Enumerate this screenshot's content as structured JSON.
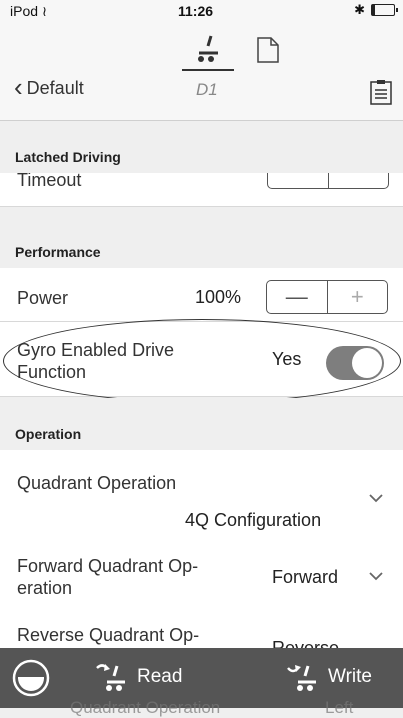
{
  "status_bar": {
    "device": "iPod",
    "time": "11:26"
  },
  "nav": {
    "back_label": "Default",
    "title": "D1"
  },
  "latched_section": {
    "header": "Latched Driving",
    "partial_row_label": "Timeout"
  },
  "performance_section": {
    "header": "Performance",
    "power": {
      "label": "Power",
      "value": "100%",
      "minus": "—",
      "plus": "+"
    },
    "gyro": {
      "label": "Gyro Enabled Drive Function",
      "value": "Yes",
      "enabled": true
    }
  },
  "operation_section": {
    "header": "Operation",
    "rows": [
      {
        "label": "Quadrant Operation",
        "value": "4Q Configuration"
      },
      {
        "label": "Forward Quadrant Op-eration",
        "value": "Forward"
      },
      {
        "label": "Reverse Quadrant Op-",
        "value": "Reverse"
      }
    ],
    "ghost_row": {
      "label": "Quadrant Operation",
      "value": "Left"
    }
  },
  "toolbar": {
    "read_label": "Read",
    "write_label": "Write"
  },
  "colors": {
    "toolbar_bg": "#555555",
    "toggle_on": "#7e7e7e",
    "page_bg": "#efefef"
  }
}
